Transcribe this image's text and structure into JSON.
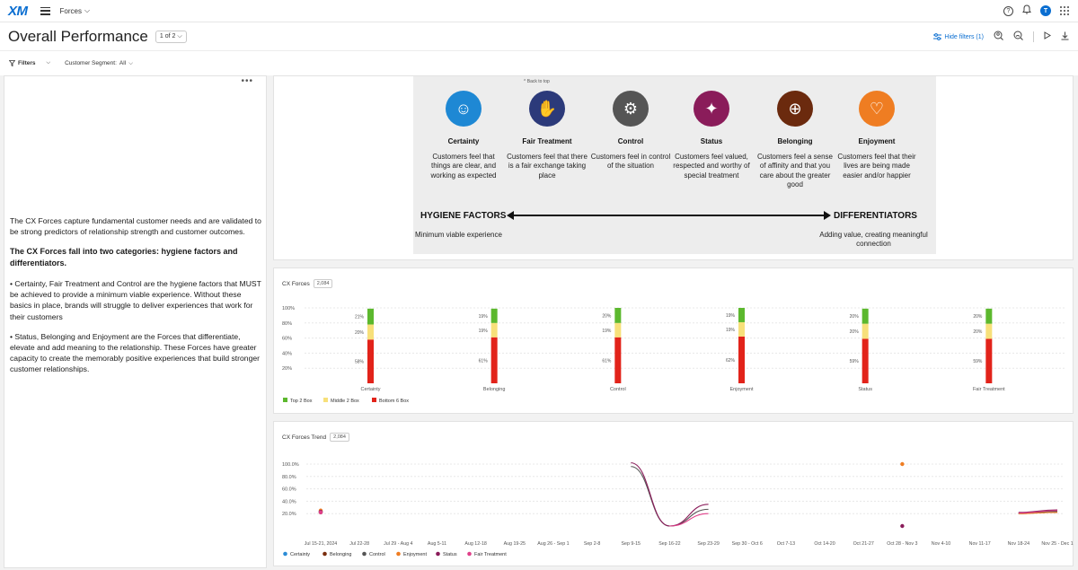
{
  "app": {
    "logo": "XM",
    "project_name": "Forces",
    "avatar_initial": "T",
    "help_glyph": "?",
    "bell_glyph": "🔔"
  },
  "header": {
    "title": "Overall Performance",
    "page_indicator": "1 of 2",
    "hide_filters_label": "Hide filters (1)"
  },
  "filters": {
    "label": "Filters",
    "segment_label": "Customer Segment:",
    "segment_value": "All"
  },
  "left_panel": {
    "p1": "The CX Forces capture fundamental customer needs and are validated to be strong predictors of relationship strength and customer outcomes.",
    "p2": "The CX Forces fall into two categories: hygiene factors and differentiators.",
    "p3": "• Certainty, Fair Treatment and Control are the hygiene factors that MUST be achieved to provide a minimum viable experience. Without these basics in place, brands will struggle to deliver experiences that work for their customers",
    "p4": "• Status, Belonging and Enjoyment are the Forces that differentiate, elevate and add meaning to the relationship. These Forces have greater capacity to create the memorably positive experiences that build stronger customer relationships."
  },
  "forces_image": {
    "back_to_top": "^ Back to top",
    "forces": [
      {
        "name": "Certainty",
        "desc": "Customers feel that things are clear, and working as expected",
        "color": "#1e88d4",
        "glyph": "☺"
      },
      {
        "name": "Fair Treatment",
        "desc": "Customers feel that there is a fair exchange taking place",
        "color": "#2c3a7a",
        "glyph": "✋"
      },
      {
        "name": "Control",
        "desc": "Customers feel in control of the situation",
        "color": "#555555",
        "glyph": "⚙"
      },
      {
        "name": "Status",
        "desc": "Customers feel valued, respected and worthy of special treatment",
        "color": "#8a1c5a",
        "glyph": "✦"
      },
      {
        "name": "Belonging",
        "desc": "Customers feel a sense of affinity and that you care about the greater good",
        "color": "#6b2a0e",
        "glyph": "⊕"
      },
      {
        "name": "Enjoyment",
        "desc": "Customers feel that their lives are being made easier and/or happier",
        "color": "#ef7d22",
        "glyph": "♡"
      }
    ],
    "hygiene_title": "HYGIENE FACTORS",
    "hygiene_sub": "Minimum viable experience",
    "diff_title": "DIFFERENTIATORS",
    "diff_sub": "Adding value, creating meaningful connection"
  },
  "chart_data": [
    {
      "type": "bar",
      "stacked": true,
      "title": "CX Forces",
      "count_badge": "2,084",
      "y_ticks": [
        "100%",
        "80%",
        "60%",
        "40%",
        "20%"
      ],
      "categories": [
        "Certainty",
        "Belonging",
        "Control",
        "Enjoyment",
        "Status",
        "Fair Treatment"
      ],
      "series": [
        {
          "name": "Bottom 6 Box",
          "values": [
            58,
            61,
            61,
            62,
            59,
            59
          ],
          "color": "#e2231a"
        },
        {
          "name": "Middle 2 Box",
          "values": [
            20,
            19,
            19,
            19,
            20,
            20
          ],
          "color": "#f7e07a"
        },
        {
          "name": "Top 2 Box",
          "values": [
            21,
            19,
            20,
            19,
            20,
            20
          ],
          "color": "#5cb82e"
        }
      ],
      "legend_position": "bottom-left"
    },
    {
      "type": "line",
      "title": "CX Forces Trend",
      "count_badge": "2,084",
      "y_ticks": [
        "100.0%",
        "80.0%",
        "60.0%",
        "40.0%",
        "20.0%"
      ],
      "ylim": [
        0,
        100
      ],
      "x": [
        "Jul 15-21, 2024",
        "Jul 22-28",
        "Jul 29 - Aug 4",
        "Aug 5-11",
        "Aug 12-18",
        "Aug 19-25",
        "Aug 26 - Sep 1",
        "Sep 2-8",
        "Sep 9-15",
        "Sep 16-22",
        "Sep 23-29",
        "Sep 30 - Oct 6",
        "Oct 7-13",
        "Oct 14-20",
        "Oct 21-27",
        "Oct 28 - Nov 3",
        "Nov 4-10",
        "Nov 11-17",
        "Nov 18-24",
        "Nov 25 - Dec 1"
      ],
      "series": [
        {
          "name": "Certainty",
          "color": "#2b8cd6",
          "values": [
            23,
            null,
            null,
            null,
            null,
            null,
            null,
            null,
            null,
            null,
            null,
            null,
            null,
            null,
            null,
            null,
            null,
            null,
            21,
            23
          ]
        },
        {
          "name": "Belonging",
          "color": "#7a2e0e",
          "values": [
            22,
            null,
            null,
            null,
            null,
            null,
            null,
            null,
            null,
            null,
            null,
            null,
            null,
            null,
            null,
            null,
            null,
            null,
            21,
            22
          ]
        },
        {
          "name": "Control",
          "color": "#555555",
          "values": [
            24,
            null,
            null,
            null,
            null,
            null,
            null,
            null,
            96,
            0,
            27,
            null,
            null,
            null,
            null,
            null,
            null,
            null,
            20,
            24
          ]
        },
        {
          "name": "Enjoyment",
          "color": "#ef7d22",
          "values": [
            25,
            null,
            null,
            null,
            null,
            null,
            null,
            null,
            null,
            null,
            null,
            null,
            null,
            null,
            null,
            100,
            null,
            null,
            20,
            22
          ]
        },
        {
          "name": "Status",
          "color": "#8a1c5a",
          "values": [
            23,
            null,
            null,
            null,
            null,
            null,
            null,
            null,
            102,
            0,
            35,
            null,
            null,
            null,
            null,
            0,
            null,
            null,
            22,
            26
          ]
        },
        {
          "name": "Fair Treatment",
          "color": "#e0408a",
          "values": [
            22,
            null,
            null,
            null,
            null,
            null,
            null,
            null,
            null,
            0,
            20,
            null,
            null,
            null,
            null,
            null,
            null,
            null,
            21,
            25
          ]
        }
      ],
      "legend_position": "bottom-left"
    }
  ]
}
